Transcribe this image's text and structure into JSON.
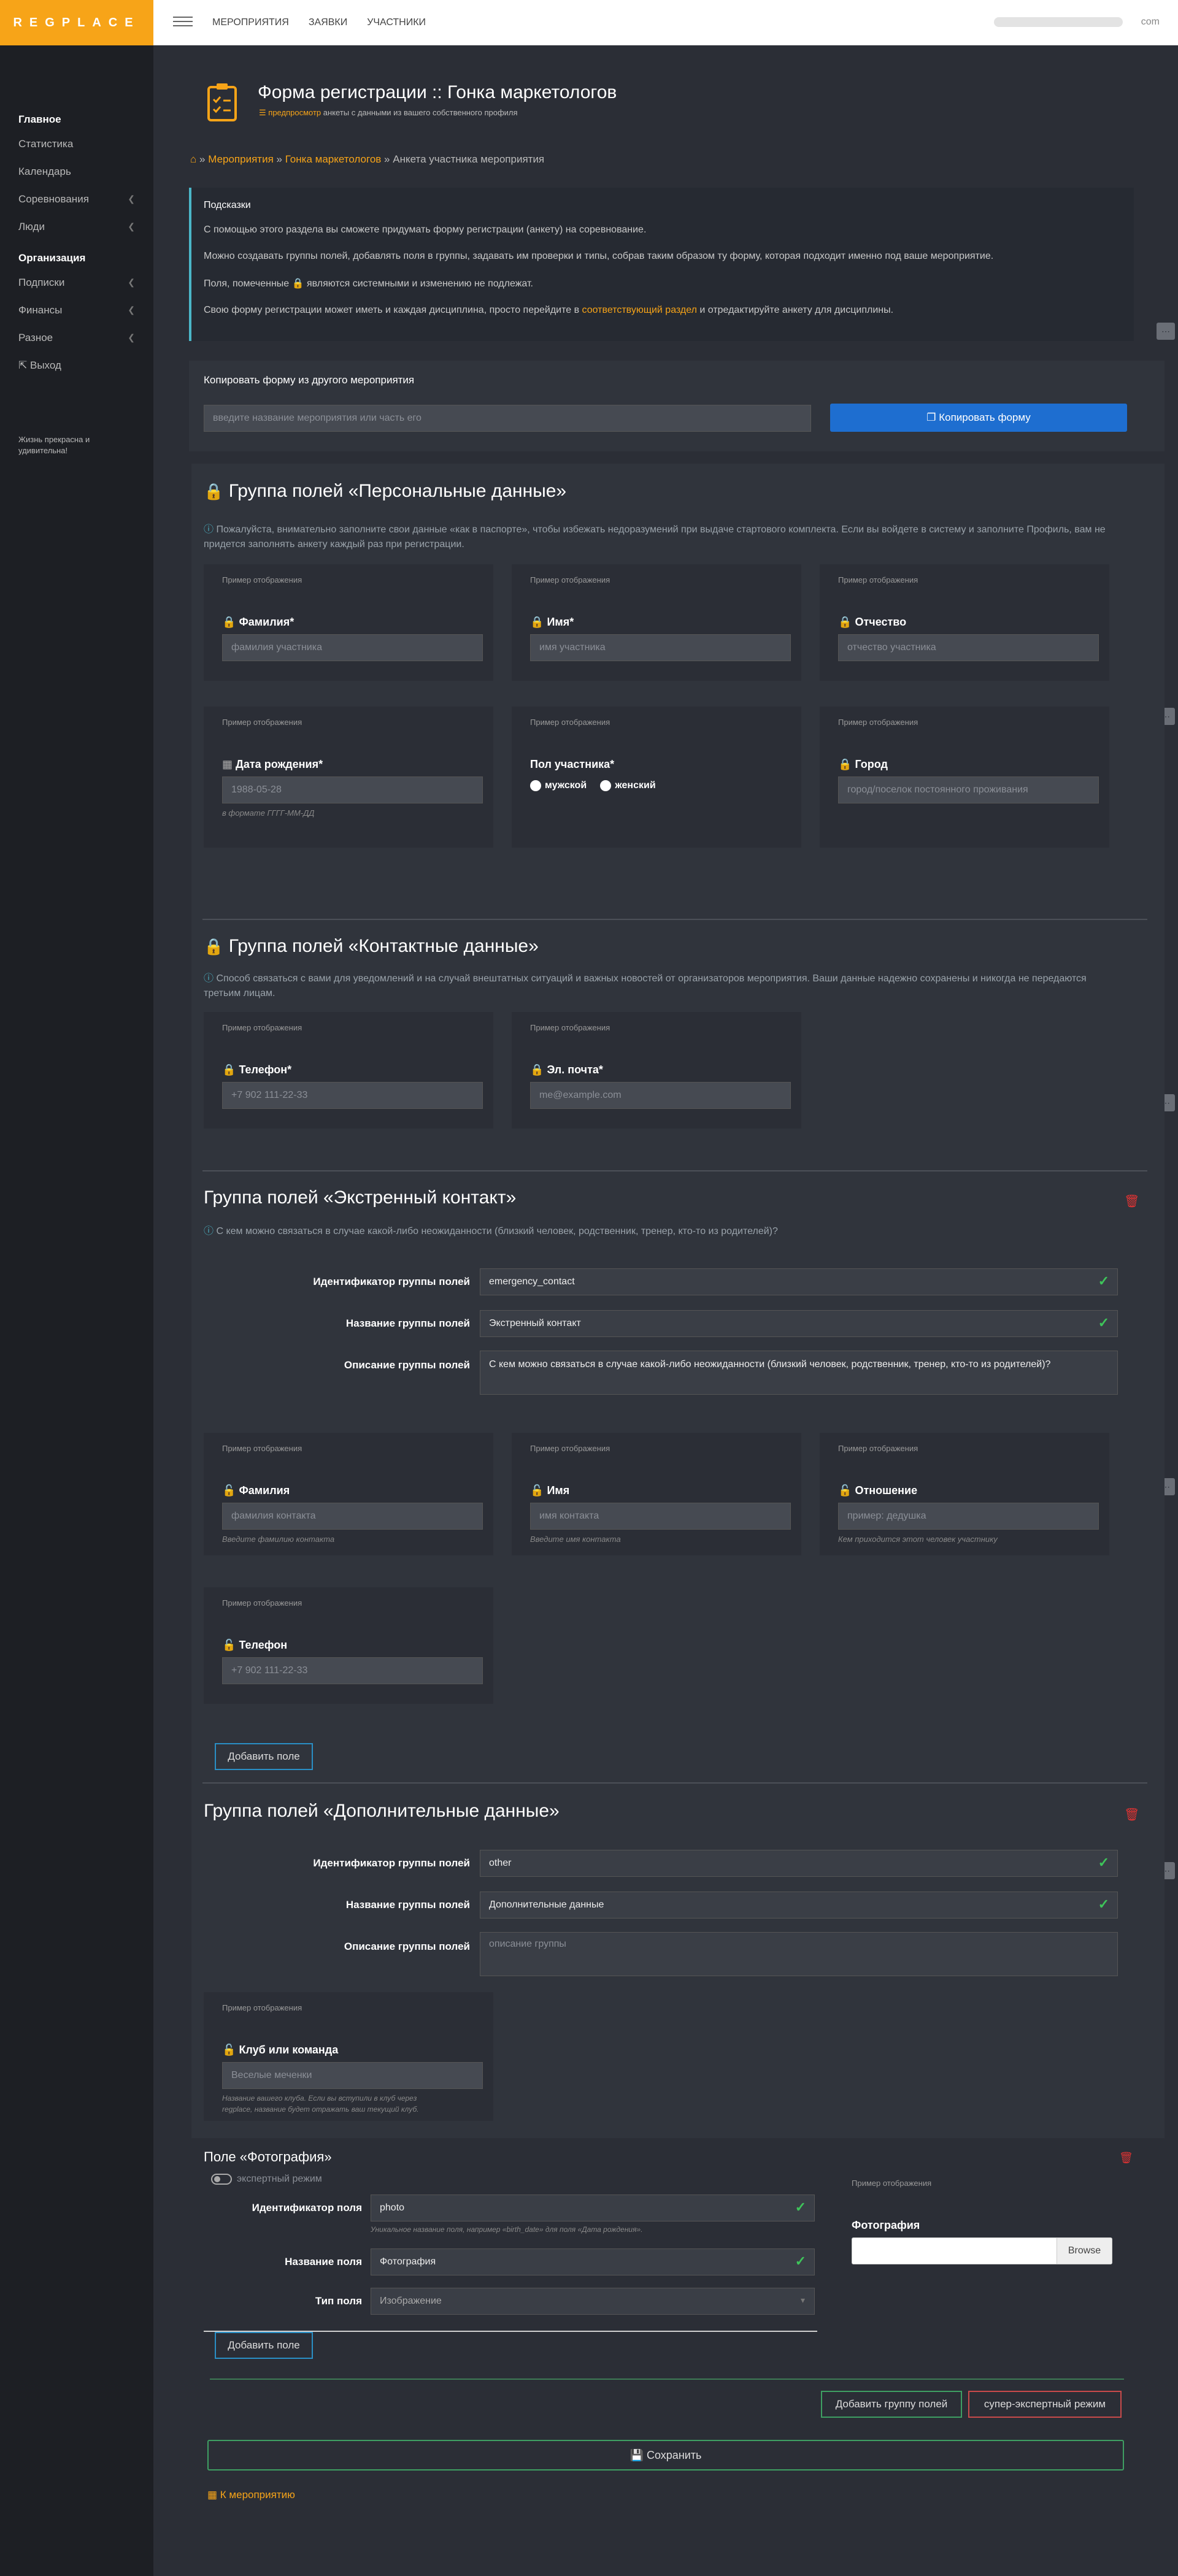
{
  "topbar": {
    "brand": "REGPLACE",
    "nav": [
      "МЕРОПРИЯТИЯ",
      "ЗАЯВКИ",
      "УЧАСТНИКИ"
    ],
    "email_domain": "com"
  },
  "sidebar": {
    "sec1": "Главное",
    "items1": [
      "Статистика",
      "Календарь",
      "Соревнования",
      "Люди"
    ],
    "sec2": "Организация",
    "items2": [
      "Подписки",
      "Финансы",
      "Разное"
    ],
    "logout": "Выход",
    "note": "Жизнь прекрасна и удивительна!"
  },
  "header": {
    "title": "Форма регистрации :: Гонка маркетологов",
    "preview_link": "предпросмотр",
    "preview_rest": "анкеты с данными из вашего собственного профиля"
  },
  "breadcrumbs": {
    "events": "Мероприятия",
    "event": "Гонка маркетологов",
    "current": "Анкета участника мероприятия",
    "sep": "»"
  },
  "hints": {
    "title": "Подсказки",
    "p1": "С помощью этого раздела вы сможете придумать форму регистрации (анкету) на соревнование.",
    "p2": "Можно создавать группы полей, добавлять поля в группы, задавать им проверки и типы, собрав таким образом ту форму, которая подходит именно под ваше мероприятие.",
    "p3a": "Поля, помеченные",
    "p3b": "являются системными и изменению не подлежат.",
    "p4a": "Свою форму регистрации может иметь и каждая дисциплина, просто перейдите в",
    "p4link": "соответствующий раздел",
    "p4b": "и отредактируйте анкету для дисциплины."
  },
  "copy_form": {
    "title": "Копировать форму из другого мероприятия",
    "placeholder": "введите название мероприятия или часть его",
    "button": "Копировать форму"
  },
  "example_label": "Пример отображения",
  "g_personal": {
    "title": "Группа полей «Персональные данные»",
    "desc": "Пожалуйста, внимательно заполните свои данные «как в паспорте», чтобы избежать недоразумений при выдаче стартового комплекта. Если вы войдете в систему и заполните Профиль, вам не придется заполнять анкету каждый раз при регистрации.",
    "fields": [
      {
        "label": "Фамилия*",
        "ph": "фамилия участника"
      },
      {
        "label": "Имя*",
        "ph": "имя участника"
      },
      {
        "label": "Отчество",
        "ph": "отчество участника"
      },
      {
        "label": "Дата рождения*",
        "ph": "1988-05-28",
        "hint": "в формате ГГГГ-ММ-ДД"
      },
      {
        "label": "Пол участника*",
        "opt1": "мужской",
        "opt2": "женский"
      },
      {
        "label": "Город",
        "ph": "город/поселок постоянного проживания"
      }
    ]
  },
  "g_contacts": {
    "title": "Группа полей «Контактные данные»",
    "desc": "Способ связаться с вами для уведомлений и на случай внештатных ситуаций и важных новостей от организаторов мероприятия. Ваши данные надежно сохранены и никогда не передаются третьим лицам.",
    "fields": [
      {
        "label": "Телефон*",
        "ph": "+7 902 111-22-33"
      },
      {
        "label": "Эл. почта*",
        "ph": "me@example.com"
      }
    ]
  },
  "g_emergency": {
    "title": "Группа полей «Экстренный контакт»",
    "desc": "С кем можно связаться в случае какой-либо неожиданности (близкий человек, родственник, тренер, кто-то из родителей)?",
    "id_label": "Идентификатор группы полей",
    "id_value": "emergency_contact",
    "name_label": "Название группы полей",
    "name_value": "Экстренный контакт",
    "desc_label": "Описание группы полей",
    "desc_value": "С кем можно связаться в случае какой-либо неожиданности (близкий человек, родственник, тренер, кто-то из родителей)?",
    "fields": [
      {
        "label": "Фамилия",
        "ph": "фамилия контакта",
        "hint": "Введите фамилию контакта"
      },
      {
        "label": "Имя",
        "ph": "имя контакта",
        "hint": "Введите имя контакта"
      },
      {
        "label": "Отношение",
        "ph": "пример: дедушка",
        "hint": "Кем приходится этот человек участнику"
      },
      {
        "label": "Телефон",
        "ph": "+7 902 111-22-33"
      }
    ],
    "add_field": "Добавить поле"
  },
  "g_extra": {
    "title": "Группа полей «Дополнительные данные»",
    "id_label": "Идентификатор группы полей",
    "id_value": "other",
    "name_label": "Название группы полей",
    "name_value": "Дополнительные данные",
    "desc_label": "Описание группы полей",
    "desc_ph": "описание группы",
    "field": {
      "label": "Клуб или команда",
      "ph": "Веселые меченки",
      "hint1": "Название вашего клуба. Если вы вступили в клуб через",
      "hint2": "regplace, название будет отражать ваш текущий клуб."
    }
  },
  "photo": {
    "title": "Поле «Фотография»",
    "expert": "экспертный режим",
    "id_label": "Идентификатор поля",
    "id_value": "photo",
    "id_hint": "Уникальное название поля, например «birth_date» для поля «Дата рождения».",
    "name_label": "Название поля",
    "name_value": "Фотография",
    "type_label": "Тип поля",
    "type_value": "Изображение",
    "preview_label": "Фотография",
    "browse": "Browse"
  },
  "footer": {
    "add_field": "Добавить поле",
    "add_group": "Добавить группу полей",
    "super_expert": "супер-экспертный режим",
    "save": "Сохранить",
    "back": "К мероприятию"
  }
}
